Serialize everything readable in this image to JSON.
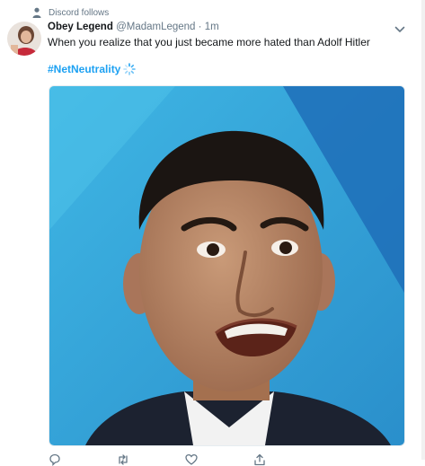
{
  "context": {
    "icon": "person-icon",
    "text": "Discord follows"
  },
  "tweet": {
    "author_name": "Obey Legend",
    "handle": "@MadamLegend",
    "separator": "·",
    "time": "1m",
    "text": "When you realize that you just became more hated than Adolf Hitler",
    "hashtag": "#NetNeutrality",
    "more_icon": "chevron-down-icon"
  },
  "actions": [
    {
      "name": "reply-icon",
      "count": ""
    },
    {
      "name": "retweet-icon",
      "count": ""
    },
    {
      "name": "like-icon",
      "count": ""
    },
    {
      "name": "share-icon",
      "count": ""
    }
  ],
  "colors": {
    "accent": "#1da1f2",
    "muted": "#657786",
    "text": "#14171a"
  }
}
